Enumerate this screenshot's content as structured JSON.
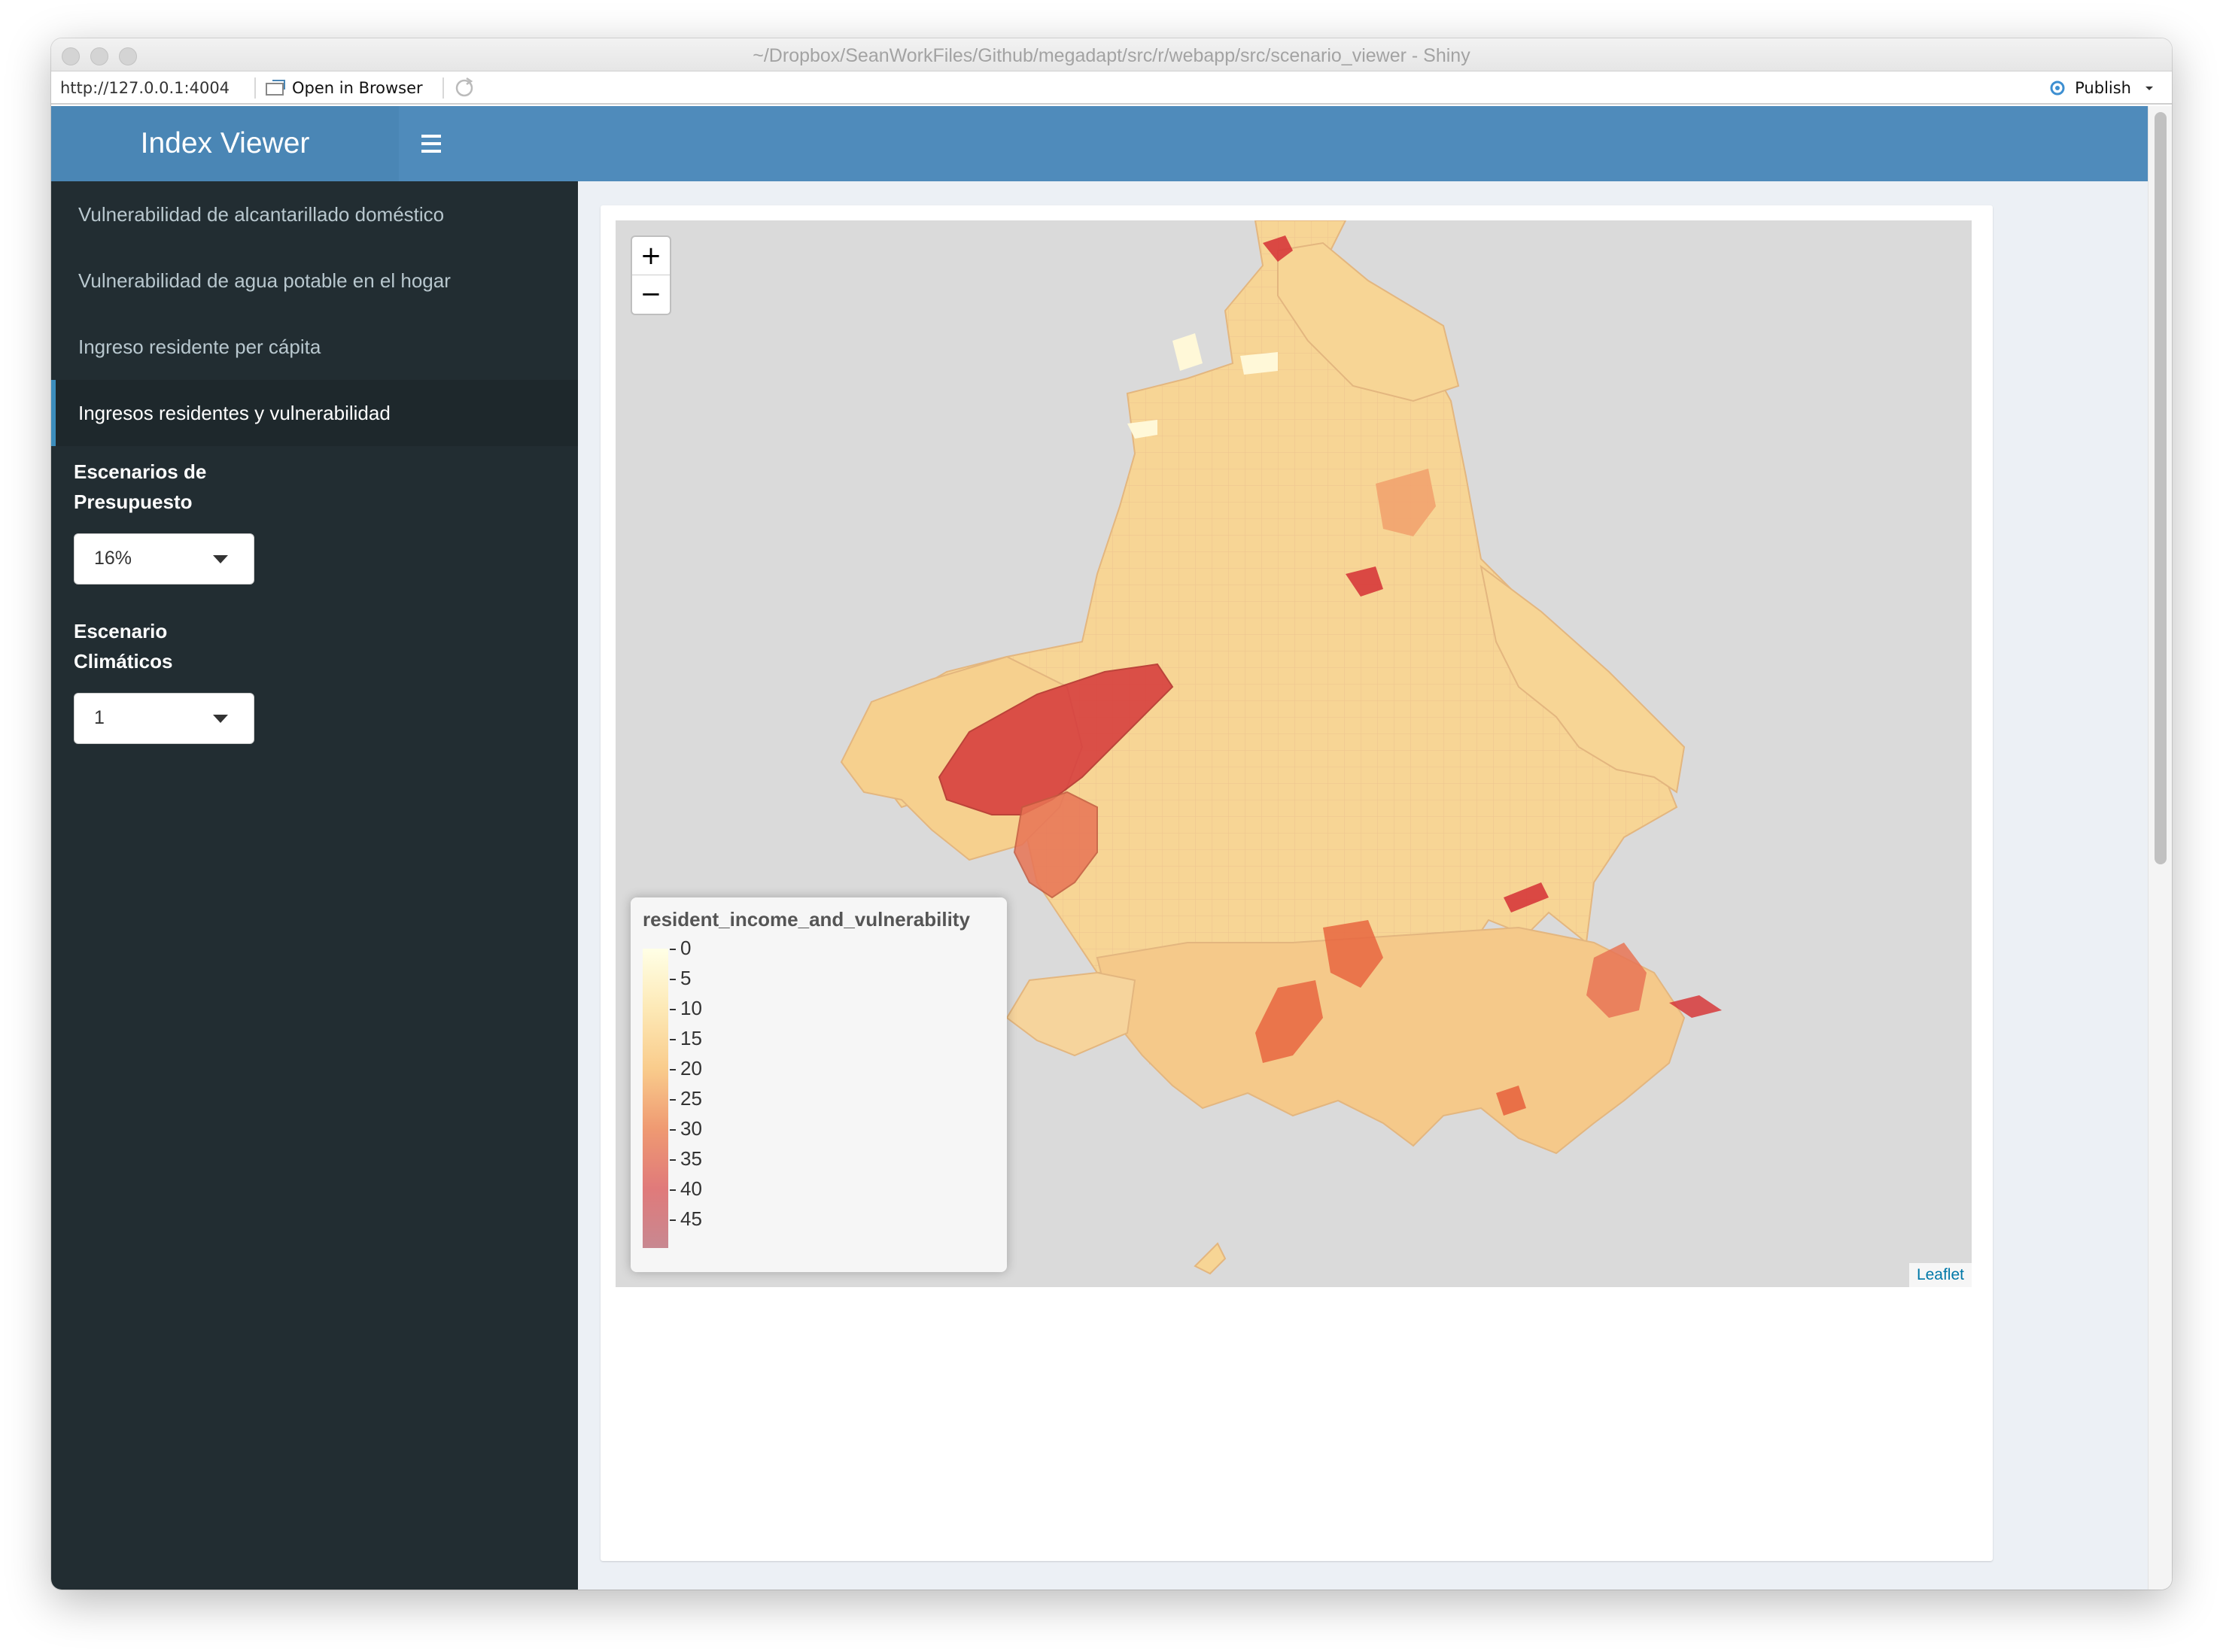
{
  "window": {
    "title": "~/Dropbox/SeanWorkFiles/Github/megadapt/src/r/webapp/src/scenario_viewer - Shiny"
  },
  "urlbar": {
    "url": "http://127.0.0.1:4004",
    "open_in_browser": "Open in Browser",
    "publish": "Publish"
  },
  "app": {
    "title": "Index Viewer"
  },
  "sidebar": {
    "items": [
      {
        "label": "Vulnerabilidad de alcantarillado doméstico"
      },
      {
        "label": "Vulnerabilidad de agua potable en el hogar"
      },
      {
        "label": "Ingreso residente per cápita"
      },
      {
        "label": "Ingresos residentes y vulnerabilidad"
      }
    ],
    "budget": {
      "label_line1": "Escenarios de",
      "label_line2": "Presupuesto",
      "value": "16%"
    },
    "climate": {
      "label_line1": "Escenario",
      "label_line2": "Climáticos",
      "value": "1"
    }
  },
  "map": {
    "zoom_in": "+",
    "zoom_out": "−",
    "attribution": "Leaflet",
    "legend": {
      "title": "resident_income_and_vulnerability",
      "ticks": [
        "0",
        "5",
        "10",
        "15",
        "20",
        "25",
        "30",
        "35",
        "40",
        "45"
      ]
    },
    "colors": {
      "background": "#dadada",
      "low": "#ffffe6",
      "mid": "#f9cc8c",
      "high": "#d6383a"
    }
  },
  "theme": {
    "header": "#4f8bbb",
    "sidebar": "#222d32",
    "accent": "#3c8dbc"
  }
}
